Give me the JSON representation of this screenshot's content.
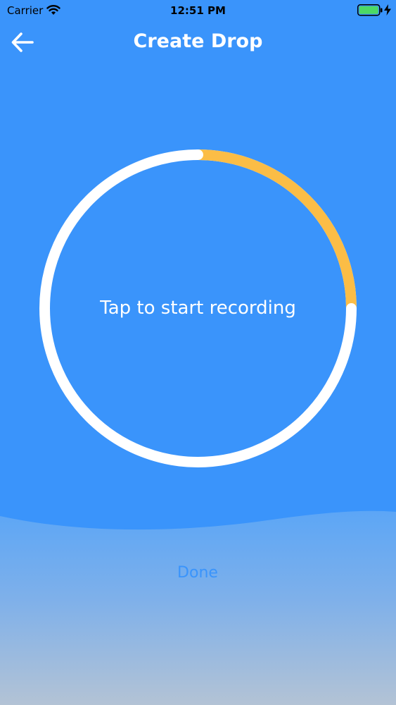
{
  "status_bar": {
    "carrier": "Carrier",
    "time": "12:51 PM",
    "battery_color": "#4cd964"
  },
  "nav": {
    "title": "Create Drop",
    "back_icon": "arrow-left-icon"
  },
  "recorder": {
    "prompt": "Tap to start recording",
    "progress": 0.25,
    "track_color": "#ffffff",
    "progress_color": "#fbbd46"
  },
  "footer": {
    "done_label": "Done"
  },
  "colors": {
    "background": "#3a94fb",
    "accent": "#3a94fb"
  }
}
